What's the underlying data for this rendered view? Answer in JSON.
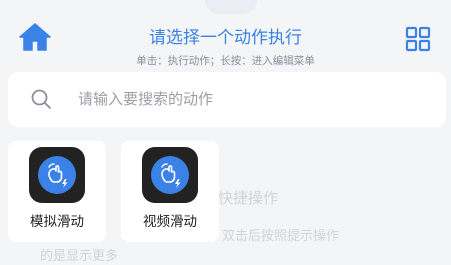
{
  "header": {
    "title": "请选择一个动作执行",
    "subtitle": "单击：执行动作；长按：进入编辑菜单",
    "home_icon": "home-icon",
    "grid_icon": "grid-icon"
  },
  "search": {
    "placeholder": "请输入要搜索的动作",
    "value": "",
    "icon": "search-icon"
  },
  "actions": [
    {
      "label": "模拟滑动",
      "icon": "swipe-gesture-icon"
    },
    {
      "label": "视频滑动",
      "icon": "swipe-gesture-icon"
    }
  ],
  "background": {
    "text_1": "快捷操作",
    "text_2": "双击后按照提示操作",
    "text_3": "的是显示更多"
  },
  "colors": {
    "accent": "#3a82e6",
    "background": "#f4f5f7",
    "card": "#ffffff",
    "icon_tile": "#222222",
    "icon_circle": "#3a82e6"
  }
}
